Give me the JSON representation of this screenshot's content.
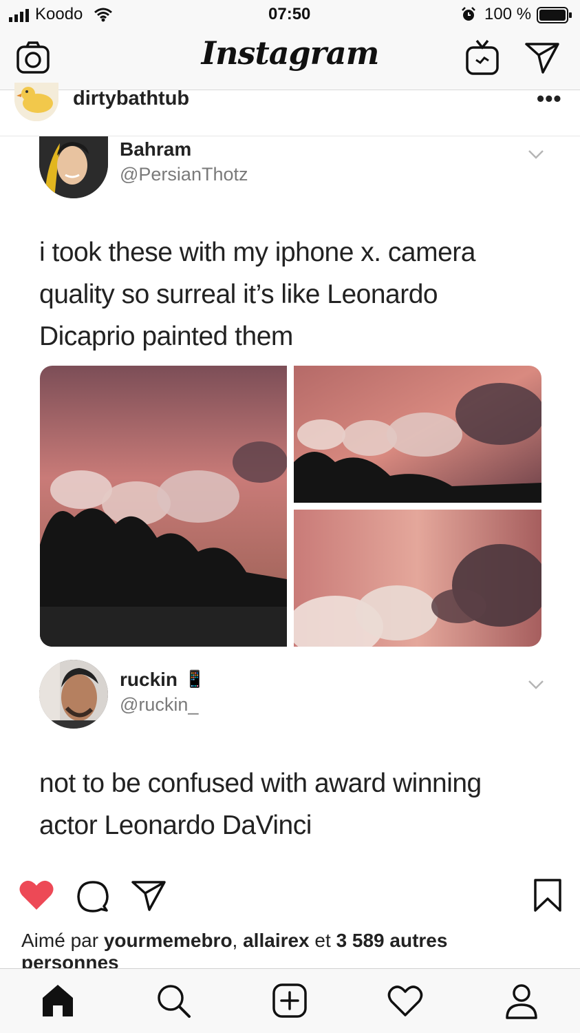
{
  "status_bar": {
    "carrier": "Koodo",
    "time": "07:50",
    "battery": "100 %"
  },
  "header": {
    "title": "Instagram",
    "icons": [
      "camera-icon",
      "igtv-icon",
      "direct-message-icon"
    ]
  },
  "post": {
    "username": "dirtybathtub",
    "more_label": "•••"
  },
  "tweets": [
    {
      "name": "Bahram",
      "handle": "@PersianThotz",
      "text_lines": [
        "i took these with my iphone x. camera",
        "quality so surreal it’s like Leonardo",
        "Dicaprio painted them"
      ]
    },
    {
      "name": "ruckin",
      "name_emoji": "📱",
      "handle": "@ruckin_",
      "text_lines": [
        "not to be confused with award winning",
        "actor Leonardo DaVinci"
      ]
    }
  ],
  "actions": {
    "liked": true,
    "likes_prefix": "Aimé par ",
    "liker_1": "yourmemebro",
    "sep": ", ",
    "liker_2": "allairex",
    "and": " et ",
    "others": "3 589 autres",
    "persons": "personnes"
  },
  "bottom_nav": {
    "icons": [
      "home-icon",
      "search-icon",
      "add-post-icon",
      "activity-heart-icon",
      "profile-icon"
    ]
  },
  "colors": {
    "like_red": "#ed4956",
    "sky_pink": "#c97b78",
    "text_dark": "#222222",
    "handle_gray": "#7a7a7a"
  }
}
